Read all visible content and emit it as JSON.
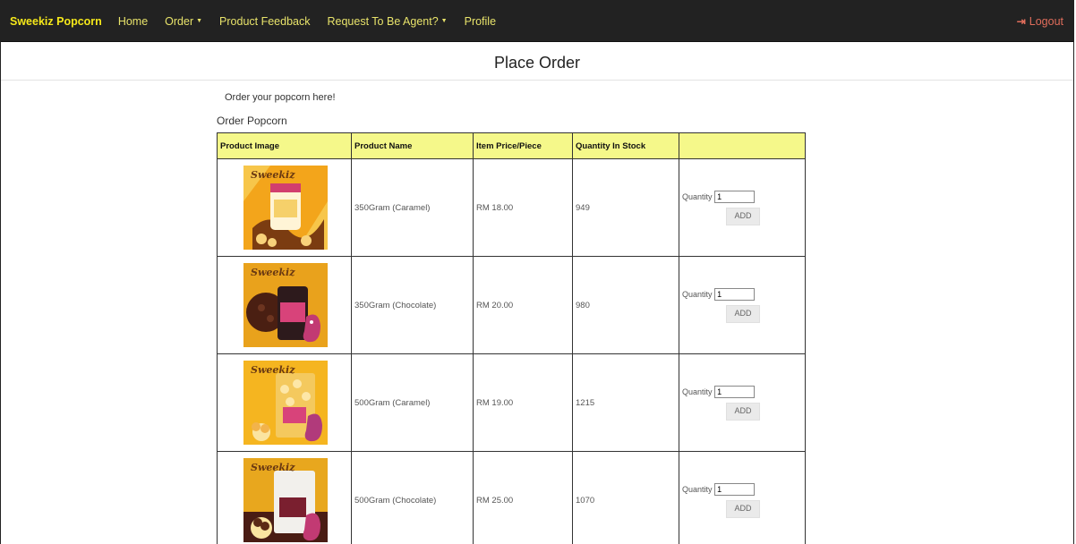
{
  "nav": {
    "brand": "Sweekiz Popcorn",
    "items": [
      {
        "label": "Home",
        "dropdown": false
      },
      {
        "label": "Order",
        "dropdown": true
      },
      {
        "label": "Product Feedback",
        "dropdown": false
      },
      {
        "label": "Request To Be Agent?",
        "dropdown": true
      },
      {
        "label": "Profile",
        "dropdown": false
      }
    ],
    "logout": "Logout",
    "logout_icon": "sign-out-icon"
  },
  "page": {
    "title": "Place Order",
    "intro": "Order your popcorn here!",
    "section": "Order Popcorn"
  },
  "table": {
    "headers": [
      "Product Image",
      "Product Name",
      "Item Price/Piece",
      "Quantity In Stock",
      ""
    ],
    "rows": [
      {
        "name": "350Gram (Caramel)",
        "price": "RM 18.00",
        "stock": "949",
        "qty_label": "Quantity",
        "qty": "1",
        "add": "ADD",
        "image_style": "caramel-jar"
      },
      {
        "name": "350Gram (Chocolate)",
        "price": "RM 20.00",
        "stock": "980",
        "qty_label": "Quantity",
        "qty": "1",
        "add": "ADD",
        "image_style": "chocolate-jar"
      },
      {
        "name": "500Gram (Caramel)",
        "price": "RM 19.00",
        "stock": "1215",
        "qty_label": "Quantity",
        "qty": "1",
        "add": "ADD",
        "image_style": "caramel-bag"
      },
      {
        "name": "500Gram (Chocolate)",
        "price": "RM 25.00",
        "stock": "1070",
        "qty_label": "Quantity",
        "qty": "1",
        "add": "ADD",
        "image_style": "chocolate-bag"
      }
    ]
  },
  "colors": {
    "navbar": "#222222",
    "brand": "#f5e81a",
    "nav_link": "#e8e36a",
    "logout": "#e06d5b",
    "table_header": "#f5f88a",
    "product_bg": "#f3a51b"
  }
}
